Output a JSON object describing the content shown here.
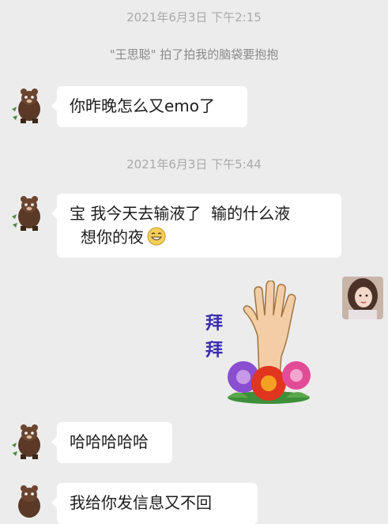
{
  "chat": {
    "timestamp_1": "2021年6月3日 下午2:15",
    "system_notice": "\"王思聪\" 拍了拍我的脑袋要抱抱",
    "msg_1": "你昨晚怎么又emo了",
    "timestamp_2": "2021年6月3日 下午5:44",
    "msg_2_line1": "宝 我今天去输液了  输的什么液",
    "msg_2_line2": "想你的夜",
    "msg_2_emoji": "grin-emoji",
    "sticker_char_1": "拜",
    "sticker_char_2": "拜",
    "msg_3": "哈哈哈哈哈",
    "msg_4": "我给你发信息又不回"
  },
  "icons": {
    "contact_avatar": "cartoon-bear-avatar",
    "self_avatar": "girl-photo-avatar",
    "sticker": "waving-hand-with-flowers"
  },
  "colors": {
    "background": "#ececec",
    "bubble": "#ffffff",
    "timestamp": "#a9a9a9",
    "sticker_text": "#3b2db5"
  }
}
